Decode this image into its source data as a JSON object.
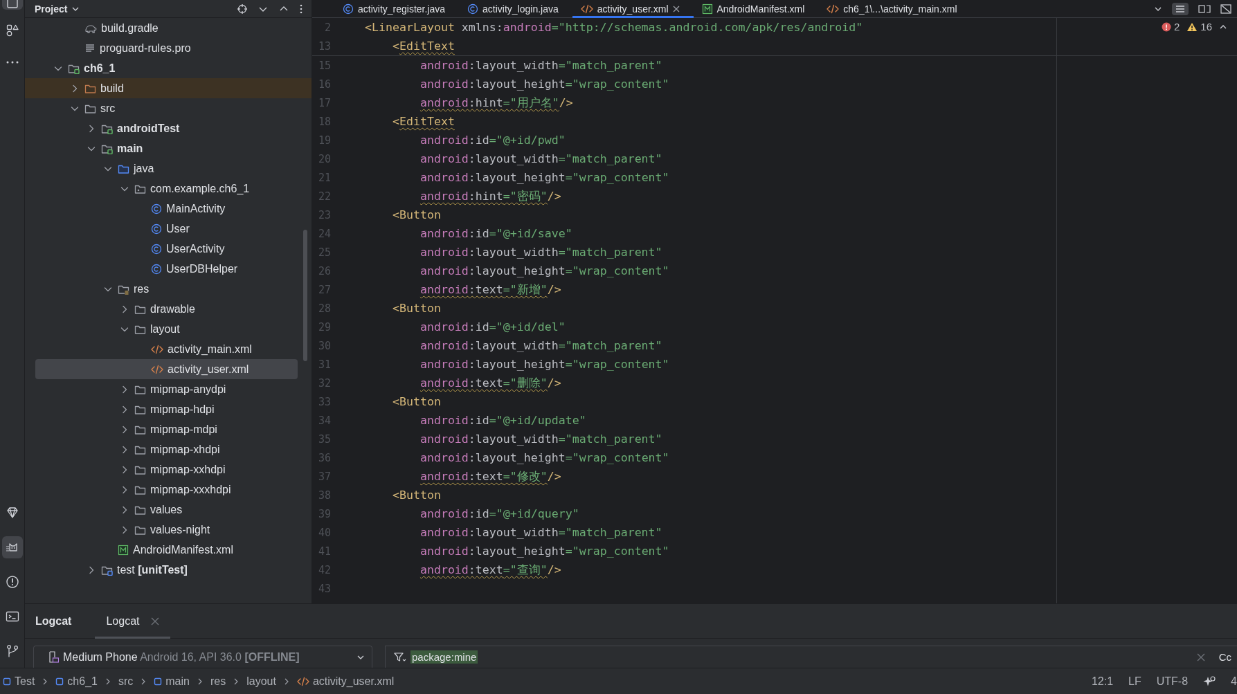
{
  "tool_window_bar": {
    "top_buttons": [
      {
        "selected": true
      },
      {
        "selected": false
      },
      {
        "selected": false
      }
    ],
    "bottom_buttons": [
      {
        "selected": false
      },
      {
        "selected": true
      },
      {
        "selected": false
      },
      {
        "selected": false
      },
      {
        "selected": false
      }
    ]
  },
  "project": {
    "title": "Project",
    "previous_module_items": [
      {
        "label": "build.gradle",
        "kind": "gradle",
        "selected": false
      },
      {
        "label": "proguard-rules.pro",
        "kind": "text-file",
        "selected": false
      }
    ],
    "items": [
      {
        "label": "ch6_1",
        "kind": "module",
        "expanded": true,
        "selected": false,
        "children": [
          {
            "label": "build",
            "kind": "folder",
            "expanded": false,
            "excluded": true,
            "selected": false
          },
          {
            "label": "src",
            "kind": "folder",
            "expanded": true,
            "selected": false,
            "children": [
              {
                "label": "androidTest",
                "kind": "source-set",
                "expanded": false,
                "selected": false
              },
              {
                "label": "main",
                "kind": "source-set",
                "expanded": true,
                "selected": false,
                "children": [
                  {
                    "label": "java",
                    "kind": "java-folder",
                    "expanded": true,
                    "selected": false,
                    "children": [
                      {
                        "label": "com.example.ch6_1",
                        "kind": "package",
                        "expanded": true,
                        "selected": false,
                        "children": [
                          {
                            "label": "MainActivity",
                            "kind": "class",
                            "selected": false
                          },
                          {
                            "label": "User",
                            "kind": "class",
                            "selected": false
                          },
                          {
                            "label": "UserActivity",
                            "kind": "class",
                            "selected": false
                          },
                          {
                            "label": "UserDBHelper",
                            "kind": "class",
                            "selected": false
                          }
                        ]
                      }
                    ]
                  },
                  {
                    "label": "res",
                    "kind": "res-folder",
                    "expanded": true,
                    "selected": false,
                    "children": [
                      {
                        "label": "drawable",
                        "kind": "folder",
                        "expanded": false,
                        "selected": false
                      },
                      {
                        "label": "layout",
                        "kind": "folder",
                        "expanded": true,
                        "selected": false,
                        "children": [
                          {
                            "label": "activity_main.xml",
                            "kind": "xml",
                            "selected": false
                          },
                          {
                            "label": "activity_user.xml",
                            "kind": "xml",
                            "selected": true
                          }
                        ]
                      },
                      {
                        "label": "mipmap-anydpi",
                        "kind": "folder",
                        "expanded": false,
                        "selected": false
                      },
                      {
                        "label": "mipmap-hdpi",
                        "kind": "folder",
                        "expanded": false,
                        "selected": false
                      },
                      {
                        "label": "mipmap-mdpi",
                        "kind": "folder",
                        "expanded": false,
                        "selected": false
                      },
                      {
                        "label": "mipmap-xhdpi",
                        "kind": "folder",
                        "expanded": false,
                        "selected": false
                      },
                      {
                        "label": "mipmap-xxhdpi",
                        "kind": "folder",
                        "expanded": false,
                        "selected": false
                      },
                      {
                        "label": "mipmap-xxxhdpi",
                        "kind": "folder",
                        "expanded": false,
                        "selected": false
                      },
                      {
                        "label": "values",
                        "kind": "folder",
                        "expanded": false,
                        "selected": false
                      },
                      {
                        "label": "values-night",
                        "kind": "folder",
                        "expanded": false,
                        "selected": false
                      }
                    ]
                  },
                  {
                    "label": "AndroidManifest.xml",
                    "kind": "manifest",
                    "selected": false
                  }
                ]
              },
              {
                "label": "test **[unitTest]**",
                "kind": "test-set",
                "expanded": false,
                "selected": false
              }
            ]
          }
        ]
      }
    ]
  },
  "editor_tabs": [
    {
      "label": "activity_register.java",
      "kind": "class",
      "selected": false
    },
    {
      "label": "activity_login.java",
      "kind": "class",
      "selected": false
    },
    {
      "label": "activity_user.xml",
      "kind": "xml",
      "selected": true
    },
    {
      "label": "AndroidManifest.xml",
      "kind": "manifest",
      "selected": false
    },
    {
      "label": "ch6_1\\...\\activity_main.xml",
      "kind": "xml",
      "selected": false
    }
  ],
  "editor": {
    "errors": "2",
    "warnings": "16",
    "sticky_lines": [
      {
        "number": "2",
        "kind": "root",
        "tokens": [
          {
            "kind": "tag",
            "text": "<LinearLayout"
          },
          {
            "kind": "attr",
            "text": " xmlns:"
          },
          {
            "kind": "ns",
            "text": "android"
          },
          {
            "kind": "str",
            "text": "=\"http://schemas.android.com/apk/res/android\""
          }
        ]
      },
      {
        "number": "13",
        "kind": "element",
        "tokens": [
          {
            "kind": "tag",
            "text": "<"
          },
          {
            "kind": "tag",
            "text": "EditText",
            "warning": true
          }
        ]
      }
    ],
    "lines": [
      {
        "number": "15",
        "kind": "attribute",
        "tokens": [
          {
            "kind": "ns",
            "text": "android"
          },
          {
            "kind": "attr",
            "text": ":layout_width"
          },
          {
            "kind": "str",
            "text": "=\"match_parent\""
          }
        ]
      },
      {
        "number": "16",
        "kind": "attribute",
        "tokens": [
          {
            "kind": "ns",
            "text": "android"
          },
          {
            "kind": "attr",
            "text": ":layout_height"
          },
          {
            "kind": "str",
            "text": "=\"wrap_content\""
          }
        ]
      },
      {
        "number": "17",
        "kind": "attribute",
        "tokens": [
          {
            "kind": "ns",
            "text": "android",
            "warning": true
          },
          {
            "kind": "attr",
            "text": ":hint",
            "warning": true
          },
          {
            "kind": "str",
            "text": "=\"用户名\"",
            "warning": true
          },
          {
            "kind": "tag",
            "text": "/>"
          }
        ]
      },
      {
        "number": "18",
        "kind": "element",
        "tokens": [
          {
            "kind": "tag",
            "text": "<"
          },
          {
            "kind": "tag",
            "text": "EditText",
            "warning": true
          }
        ]
      },
      {
        "number": "19",
        "kind": "attribute",
        "tokens": [
          {
            "kind": "ns",
            "text": "android"
          },
          {
            "kind": "attr",
            "text": ":id"
          },
          {
            "kind": "str",
            "text": "=\"@+id/pwd\""
          }
        ]
      },
      {
        "number": "20",
        "kind": "attribute",
        "tokens": [
          {
            "kind": "ns",
            "text": "android"
          },
          {
            "kind": "attr",
            "text": ":layout_width"
          },
          {
            "kind": "str",
            "text": "=\"match_parent\""
          }
        ]
      },
      {
        "number": "21",
        "kind": "attribute",
        "tokens": [
          {
            "kind": "ns",
            "text": "android"
          },
          {
            "kind": "attr",
            "text": ":layout_height"
          },
          {
            "kind": "str",
            "text": "=\"wrap_content\""
          }
        ]
      },
      {
        "number": "22",
        "kind": "attribute",
        "tokens": [
          {
            "kind": "ns",
            "text": "android",
            "warning": true
          },
          {
            "kind": "attr",
            "text": ":hint",
            "warning": true
          },
          {
            "kind": "str",
            "text": "=\"密码\"",
            "warning": true
          },
          {
            "kind": "tag",
            "text": "/>"
          }
        ]
      },
      {
        "number": "23",
        "kind": "element",
        "tokens": [
          {
            "kind": "tag",
            "text": "<Button"
          }
        ]
      },
      {
        "number": "24",
        "kind": "attribute",
        "tokens": [
          {
            "kind": "ns",
            "text": "android"
          },
          {
            "kind": "attr",
            "text": ":id"
          },
          {
            "kind": "str",
            "text": "=\"@+id/save\""
          }
        ]
      },
      {
        "number": "25",
        "kind": "attribute",
        "tokens": [
          {
            "kind": "ns",
            "text": "android"
          },
          {
            "kind": "attr",
            "text": ":layout_width"
          },
          {
            "kind": "str",
            "text": "=\"match_parent\""
          }
        ]
      },
      {
        "number": "26",
        "kind": "attribute",
        "tokens": [
          {
            "kind": "ns",
            "text": "android"
          },
          {
            "kind": "attr",
            "text": ":layout_height"
          },
          {
            "kind": "str",
            "text": "=\"wrap_content\""
          }
        ]
      },
      {
        "number": "27",
        "kind": "attribute",
        "tokens": [
          {
            "kind": "ns",
            "text": "android",
            "warning": true
          },
          {
            "kind": "attr",
            "text": ":text",
            "warning": true
          },
          {
            "kind": "str",
            "text": "=\"新增\"",
            "warning": true
          },
          {
            "kind": "tag",
            "text": "/>"
          }
        ]
      },
      {
        "number": "28",
        "kind": "element",
        "tokens": [
          {
            "kind": "tag",
            "text": "<Button"
          }
        ]
      },
      {
        "number": "29",
        "kind": "attribute",
        "tokens": [
          {
            "kind": "ns",
            "text": "android"
          },
          {
            "kind": "attr",
            "text": ":id"
          },
          {
            "kind": "str",
            "text": "=\"@+id/del\""
          }
        ]
      },
      {
        "number": "30",
        "kind": "attribute",
        "tokens": [
          {
            "kind": "ns",
            "text": "android"
          },
          {
            "kind": "attr",
            "text": ":layout_width"
          },
          {
            "kind": "str",
            "text": "=\"match_parent\""
          }
        ]
      },
      {
        "number": "31",
        "kind": "attribute",
        "tokens": [
          {
            "kind": "ns",
            "text": "android"
          },
          {
            "kind": "attr",
            "text": ":layout_height"
          },
          {
            "kind": "str",
            "text": "=\"wrap_content\""
          }
        ]
      },
      {
        "number": "32",
        "kind": "attribute",
        "tokens": [
          {
            "kind": "ns",
            "text": "android",
            "warning": true
          },
          {
            "kind": "attr",
            "text": ":text",
            "warning": true
          },
          {
            "kind": "str",
            "text": "=\"删除\"",
            "warning": true
          },
          {
            "kind": "tag",
            "text": "/>"
          }
        ]
      },
      {
        "number": "33",
        "kind": "element",
        "tokens": [
          {
            "kind": "tag",
            "text": "<Button"
          }
        ]
      },
      {
        "number": "34",
        "kind": "attribute",
        "tokens": [
          {
            "kind": "ns",
            "text": "android"
          },
          {
            "kind": "attr",
            "text": ":id"
          },
          {
            "kind": "str",
            "text": "=\"@+id/update\""
          }
        ]
      },
      {
        "number": "35",
        "kind": "attribute",
        "tokens": [
          {
            "kind": "ns",
            "text": "android"
          },
          {
            "kind": "attr",
            "text": ":layout_width"
          },
          {
            "kind": "str",
            "text": "=\"match_parent\""
          }
        ]
      },
      {
        "number": "36",
        "kind": "attribute",
        "tokens": [
          {
            "kind": "ns",
            "text": "android"
          },
          {
            "kind": "attr",
            "text": ":layout_height"
          },
          {
            "kind": "str",
            "text": "=\"wrap_content\""
          }
        ]
      },
      {
        "number": "37",
        "kind": "attribute",
        "tokens": [
          {
            "kind": "ns",
            "text": "android",
            "warning": true
          },
          {
            "kind": "attr",
            "text": ":text",
            "warning": true
          },
          {
            "kind": "str",
            "text": "=\"修改\"",
            "warning": true
          },
          {
            "kind": "tag",
            "text": "/>"
          }
        ]
      },
      {
        "number": "38",
        "kind": "element",
        "tokens": [
          {
            "kind": "tag",
            "text": "<Button"
          }
        ]
      },
      {
        "number": "39",
        "kind": "attribute",
        "tokens": [
          {
            "kind": "ns",
            "text": "android"
          },
          {
            "kind": "attr",
            "text": ":id"
          },
          {
            "kind": "str",
            "text": "=\"@+id/query\""
          }
        ]
      },
      {
        "number": "40",
        "kind": "attribute",
        "tokens": [
          {
            "kind": "ns",
            "text": "android"
          },
          {
            "kind": "attr",
            "text": ":layout_width"
          },
          {
            "kind": "str",
            "text": "=\"match_parent\""
          }
        ]
      },
      {
        "number": "41",
        "kind": "attribute",
        "tokens": [
          {
            "kind": "ns",
            "text": "android"
          },
          {
            "kind": "attr",
            "text": ":layout_height"
          },
          {
            "kind": "str",
            "text": "=\"wrap_content\""
          }
        ]
      },
      {
        "number": "42",
        "kind": "attribute",
        "tokens": [
          {
            "kind": "ns",
            "text": "android",
            "warning": true
          },
          {
            "kind": "attr",
            "text": ":text",
            "warning": true
          },
          {
            "kind": "str",
            "text": "=\"查询\"",
            "warning": true
          },
          {
            "kind": "tag",
            "text": "/>"
          }
        ]
      },
      {
        "number": "43"
      }
    ]
  },
  "logcat": {
    "title": "Logcat",
    "tabs": [
      {
        "label": "Logcat",
        "selected": true
      }
    ],
    "device": {
      "name": "Medium Phone",
      "details": "Android 16, API 36.0",
      "status": "[OFFLINE]"
    },
    "filter": {
      "value": "package:mine"
    },
    "case_button": "Cc"
  },
  "status_bar": {
    "breadcrumbs": [
      {
        "label": "Test",
        "kind": "module"
      },
      {
        "label": "ch6_1",
        "kind": "module"
      },
      {
        "label": "src",
        "kind": "folder"
      },
      {
        "label": "main",
        "kind": "module"
      },
      {
        "label": "res",
        "kind": "folder"
      },
      {
        "label": "layout",
        "kind": "folder"
      },
      {
        "label": "activity_user.xml",
        "kind": "xml"
      }
    ],
    "items": [
      "12:1",
      "LF",
      "UTF-8"
    ],
    "trailing": "4"
  }
}
